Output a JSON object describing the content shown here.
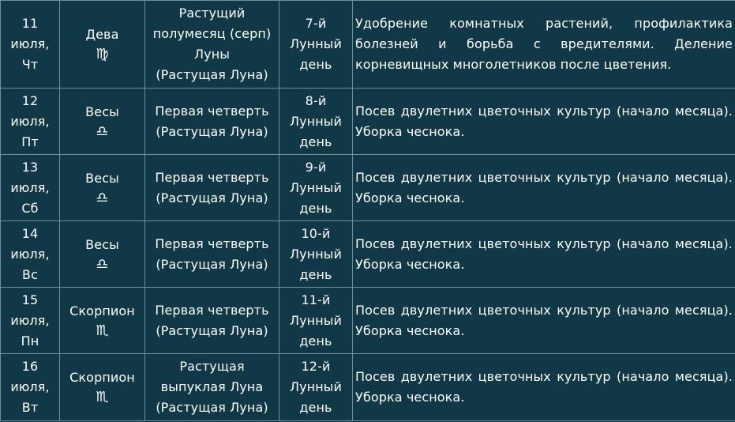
{
  "rows": [
    {
      "date": [
        "11",
        "июля,",
        "Чт"
      ],
      "sign": "Дева",
      "sign_glyph": "♍",
      "phase": [
        "Растущий",
        "полумесяц (серп)",
        "Луны",
        "(Растущая Луна)"
      ],
      "lunar_day": [
        "7-й",
        "Лунный",
        "день"
      ],
      "task": "Удобрение комнатных растений, профилактика болезней и борьба с вредителями. Деление корневищных многолетников после цветения."
    },
    {
      "date": [
        "12",
        "июля,",
        "Пт"
      ],
      "sign": "Весы",
      "sign_glyph": "♎",
      "phase": [
        "Первая четверть",
        "(Растущая Луна)"
      ],
      "lunar_day": [
        "8-й",
        "Лунный",
        "день"
      ],
      "task": "Посев двулетних цветочных культур (начало месяца). Уборка чеснока."
    },
    {
      "date": [
        "13",
        "июля,",
        "Сб"
      ],
      "sign": "Весы",
      "sign_glyph": "♎",
      "phase": [
        "Первая четверть",
        "(Растущая Луна)"
      ],
      "lunar_day": [
        "9-й",
        "Лунный",
        "день"
      ],
      "task": "Посев двулетних цветочных культур (начало месяца). Уборка чеснока."
    },
    {
      "date": [
        "14",
        "июля,",
        "Вс"
      ],
      "sign": "Весы",
      "sign_glyph": "♎",
      "phase": [
        "Первая четверть",
        "(Растущая Луна)"
      ],
      "lunar_day": [
        "10-й",
        "Лунный",
        "день"
      ],
      "task": "Посев двулетних цветочных культур (начало месяца). Уборка чеснока."
    },
    {
      "date": [
        "15",
        "июля,",
        "Пн"
      ],
      "sign": "Скорпион",
      "sign_glyph": "♏",
      "phase": [
        "Первая четверть",
        "(Растущая Луна)"
      ],
      "lunar_day": [
        "11-й",
        "Лунный",
        "день"
      ],
      "task": "Посев двулетних цветочных культур (начало месяца). Уборка чеснока."
    },
    {
      "date": [
        "16",
        "июля,",
        "Вт"
      ],
      "sign": "Скорпион",
      "sign_glyph": "♏",
      "phase": [
        "Растущая",
        "выпуклая Луна",
        "(Растущая Луна)"
      ],
      "lunar_day": [
        "12-й",
        "Лунный",
        "день"
      ],
      "task": "Посев двулетних цветочных культур (начало месяца). Уборка чеснока."
    }
  ],
  "colors": {
    "cell_background": "#103847",
    "border": "#6f8f99",
    "text": "#ffffff"
  }
}
